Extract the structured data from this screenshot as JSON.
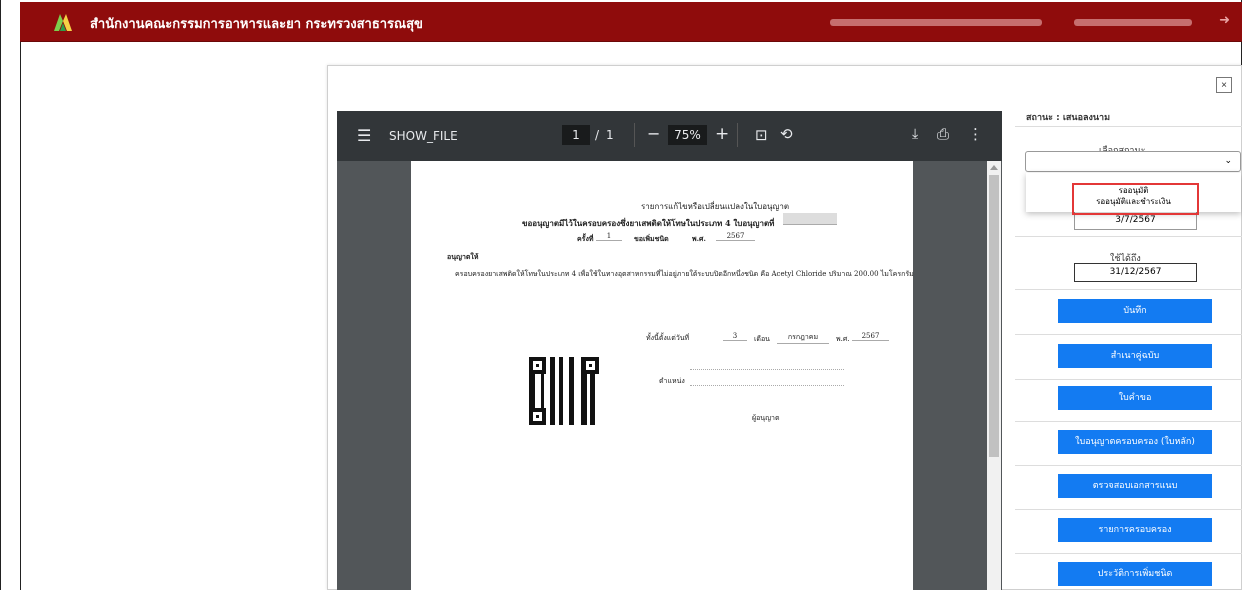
{
  "header": {
    "title": "สำนักงานคณะกรรมการอาหารและยา กระทรวงสาธารณสุข",
    "logout_icon": "logout-icon"
  },
  "colors": {
    "header_red": "#8f0c0c",
    "primary_blue": "#137bf2",
    "highlight_red": "#e33737",
    "pdf_toolbar": "#323639"
  },
  "modal": {
    "close_label": "×"
  },
  "pdf": {
    "file_name": "SHOW_FILE",
    "page_current": "1",
    "page_total": "1",
    "page_separator": "/",
    "zoom": "75%",
    "icons": [
      "menu-icon",
      "minus-icon",
      "plus-icon",
      "fit-page-icon",
      "rotate-icon",
      "download-icon",
      "print-icon",
      "more-icon"
    ]
  },
  "document": {
    "title": "รายการแก้ไขหรือเปลี่ยนแปลงในใบอนุญาต",
    "license_line": "ขออนุญาตมีไว้ในครอบครองซึ่งยาเสพติดให้โทษในประเภท 4 ใบอนุญาตที่",
    "round_label": "ครั้งที่",
    "round_value": "1",
    "type_label": "ขอเพิ่มชนิด",
    "year_label": "พ.ศ.",
    "year_value": "2567",
    "grant_label": "อนุญาตให้",
    "grant_desc": "ครอบครองยาเสพติดให้โทษในประเภท 4 เพื่อใช้ในทางอุตสาหกรรมที่ไม่อยู่ภายใต้ระบบปิดอีกหนึ่งชนิด คือ Acetyl Chloride ปริมาณ 200.00 ไมโครกรัม",
    "since_label": "ทั้งนี้ตั้งแต่วันที่",
    "day_value": "3",
    "month_label": "เดือน",
    "month_value": "กรกฎาคม",
    "year_label_2": "พ.ศ.",
    "year_value_2": "2567",
    "position_label": "ตำแหน่ง",
    "licensor_label": "ผู้อนุญาต"
  },
  "sidebar": {
    "status_text": "สถานะ : เสนอลงนาม",
    "select_label": "เลือกสถานะ",
    "select_value": "",
    "dropdown_options": [
      "รออนุมัติ",
      "รออนุมัติและชำระเงิน"
    ],
    "date_from": "3/7/2567",
    "until_label": "ใช้ได้ถึง",
    "date_to": "31/12/2567",
    "buttons": [
      "บันทึก",
      "สำเนาคู่ฉบับ",
      "ใบคำขอ",
      "ใบอนุญาตครอบครอง (ใบหลัก)",
      "ตรวจสอบเอกสารแนบ",
      "รายการครอบครอง",
      "ประวัติการเพิ่มชนิด"
    ]
  }
}
